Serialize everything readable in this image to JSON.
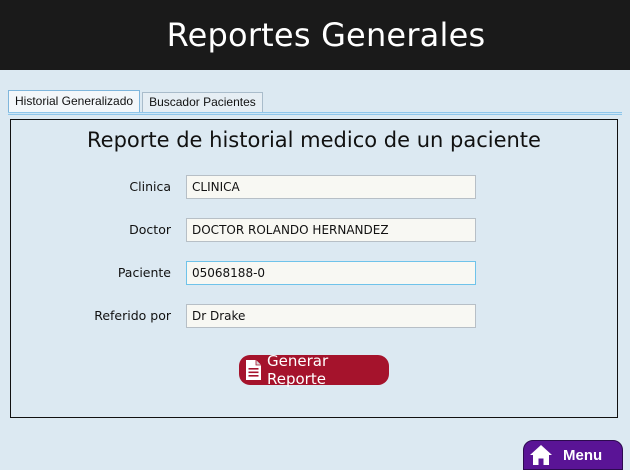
{
  "header": {
    "title": "Reportes Generales"
  },
  "tabs": [
    {
      "label": "Historial Generalizado",
      "active": true
    },
    {
      "label": "Buscador Pacientes",
      "active": false
    }
  ],
  "panel": {
    "title": "Reporte de historial medico de un paciente",
    "fields": {
      "clinica": {
        "label": "Clinica",
        "value": "CLINICA"
      },
      "doctor": {
        "label": "Doctor",
        "value": "DOCTOR ROLANDO HERNANDEZ"
      },
      "paciente": {
        "label": "Paciente",
        "value": "05068188-0"
      },
      "referido": {
        "label": "Referido por",
        "value": "Dr Drake"
      }
    },
    "generate_button": {
      "label": "Generar Reporte",
      "icon": "document-icon"
    }
  },
  "menu_button": {
    "label": "Menu",
    "icon": "home-icon"
  },
  "colors": {
    "header_bg": "#1a1a1a",
    "page_bg": "#dce9f2",
    "generate_button_bg": "#a5132c",
    "menu_button_bg": "#5a1496",
    "focus_border": "#6fc3ea"
  }
}
